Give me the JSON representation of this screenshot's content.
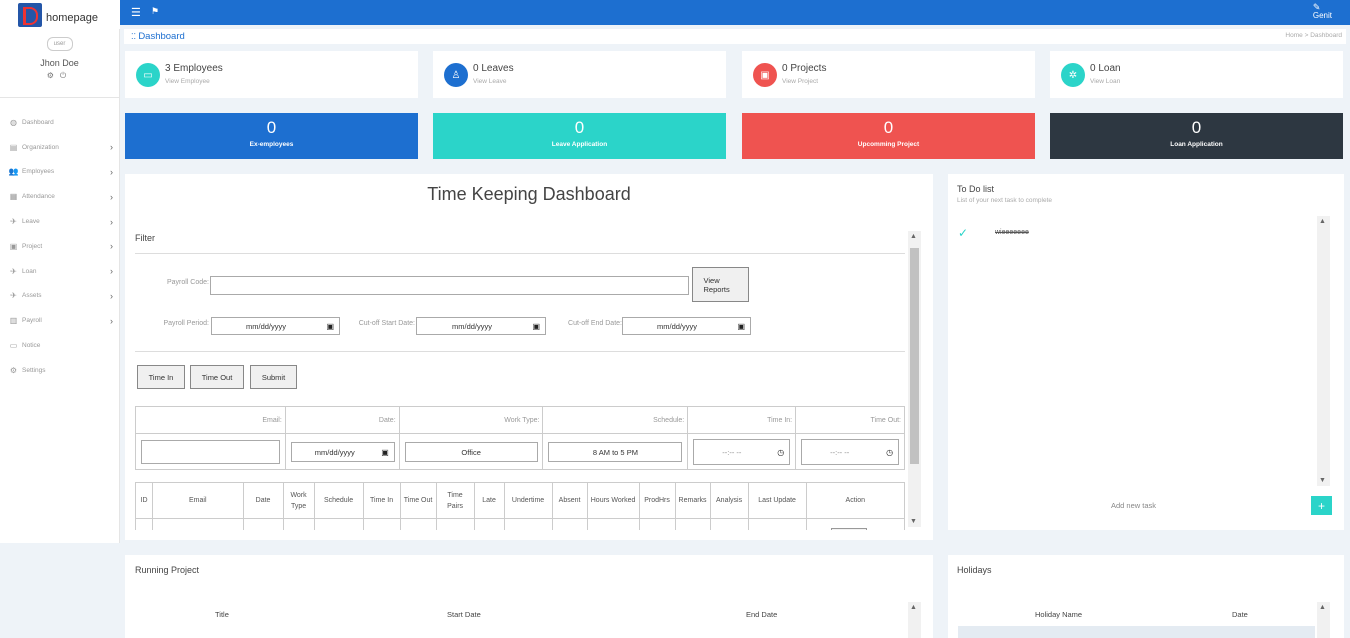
{
  "brand": {
    "logo_alt": "homepage",
    "user_label": "Genit"
  },
  "profile": {
    "avatar_alt": "user",
    "name": "Jhon Doe"
  },
  "sidebar": {
    "items": [
      {
        "label": "Dashboard",
        "icon": "dashboard-icon",
        "has_children": false
      },
      {
        "label": "Organization",
        "icon": "building-icon",
        "has_children": true
      },
      {
        "label": "Employees",
        "icon": "users-icon",
        "has_children": true
      },
      {
        "label": "Attendance",
        "icon": "clipboard-icon",
        "has_children": true
      },
      {
        "label": "Leave",
        "icon": "rocket-icon",
        "has_children": true
      },
      {
        "label": "Project",
        "icon": "briefcase-icon",
        "has_children": true
      },
      {
        "label": "Loan",
        "icon": "rocket-icon",
        "has_children": true
      },
      {
        "label": "Assets",
        "icon": "rocket-icon",
        "has_children": true
      },
      {
        "label": "Payroll",
        "icon": "money-icon",
        "has_children": true
      },
      {
        "label": "Notice",
        "icon": "file-icon",
        "has_children": false
      },
      {
        "label": "Settings",
        "icon": "gear-icon",
        "has_children": false
      }
    ]
  },
  "breadcrumb": {
    "title": "Dashboard",
    "home": "Home",
    "separator": ">",
    "current": "Dashboard"
  },
  "stats": [
    {
      "title": "3 Employees",
      "link": "View Employee",
      "color": "#2bd4c9"
    },
    {
      "title": "0 Leaves",
      "link": "View Leave",
      "color": "#1d6fd0"
    },
    {
      "title": "0 Projects",
      "link": "View Project",
      "color": "#ef5350"
    },
    {
      "title": "0 Loan",
      "link": "View Loan",
      "color": "#2bd4c9"
    }
  ],
  "summary": [
    {
      "value": "0",
      "label": "Ex-employees",
      "color": "#1d6fd0"
    },
    {
      "value": "0",
      "label": "Leave Application",
      "color": "#2bd4c9"
    },
    {
      "value": "0",
      "label": "Upcomming Project",
      "color": "#ef5350"
    },
    {
      "value": "0",
      "label": "Loan Application",
      "color": "#2d3741"
    }
  ],
  "timekeeping": {
    "title": "Time Keeping Dashboard",
    "filter_label": "Filter",
    "payroll_code_label": "Payroll Code:",
    "payroll_code_value": "",
    "view_reports_label": "View Reports",
    "payroll_period_label": "Payroll Period:",
    "cutoff_start_label": "Cut-off Start Date:",
    "cutoff_end_label": "Cut-off End Date:",
    "date_placeholder": "mm/dd/yyyy",
    "time_in_button": "Time In",
    "time_out_button": "Time Out",
    "submit_button": "Submit",
    "entry_headers": [
      "Email:",
      "Date:",
      "Work Type:",
      "Schedule:",
      "Time In:",
      "Time Out:"
    ],
    "entry_values": {
      "email": "",
      "date": "mm/dd/yyyy",
      "work_type": "Office",
      "schedule": "8 AM to 5 PM",
      "time_in": "--:-- --",
      "time_out": "--:-- --"
    },
    "table_headers": [
      "ID",
      "Email",
      "Date",
      "Work Type",
      "Schedule",
      "Time In",
      "Time Out",
      "Time Pairs",
      "Late",
      "Undertime",
      "Absent",
      "Hours Worked",
      "ProdHrs",
      "Remarks",
      "Analysis",
      "Last Update",
      "Action"
    ]
  },
  "todo": {
    "title": "To Do list",
    "subtitle": "List of your next task to complete",
    "items": [
      {
        "text": "wieeeeeee",
        "done": true
      }
    ],
    "add_label": "Add new task",
    "add_button": "+"
  },
  "running_project": {
    "title": "Running Project",
    "headers": [
      "Title",
      "Start Date",
      "End Date"
    ]
  },
  "holidays": {
    "title": "Holidays",
    "headers": [
      "Holiday Name",
      "Date"
    ]
  }
}
